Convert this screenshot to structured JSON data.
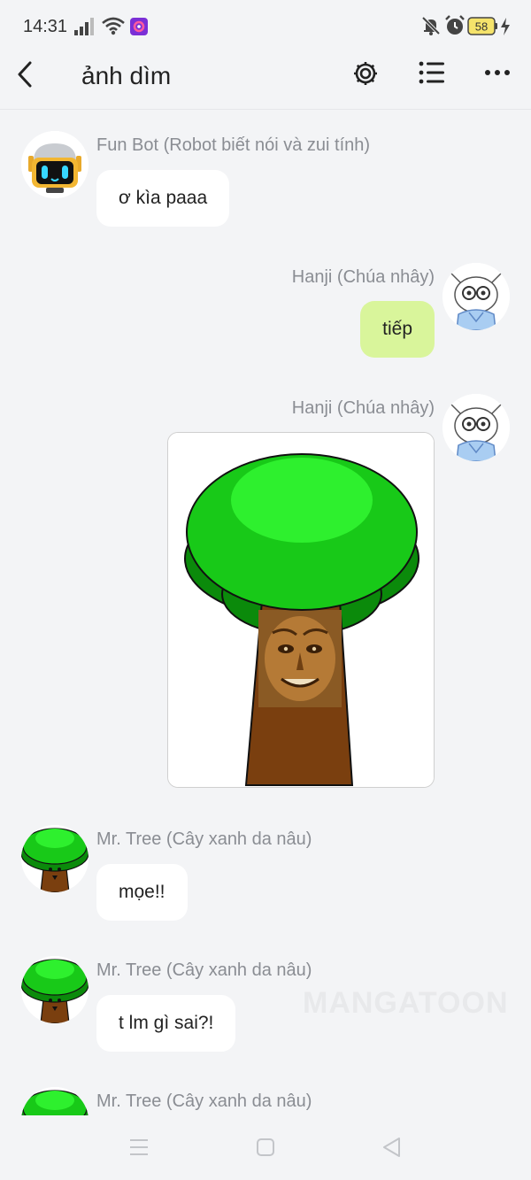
{
  "status_bar": {
    "time": "14:31",
    "battery": "58"
  },
  "header": {
    "title": "ảnh dìm"
  },
  "messages": [
    {
      "sender": "Fun Bot (Robot biết nói và zui tính)",
      "text": "ơ kìa paaa"
    },
    {
      "sender": "Hanji (Chúa nhây)",
      "text": "tiếp"
    },
    {
      "sender": "Hanji (Chúa nhây)"
    },
    {
      "sender": "Mr. Tree (Cây xanh da nâu)",
      "text": "mọe!!"
    },
    {
      "sender": "Mr. Tree (Cây xanh da nâu)",
      "text": "t lm gì sai?!"
    },
    {
      "sender": "Mr. Tree (Cây xanh da nâu)"
    }
  ],
  "watermark": "MANGATOON",
  "colors": {
    "background": "#f3f4f6",
    "outgoing_bubble": "#d9f59b",
    "incoming_bubble": "#ffffff",
    "sender_name": "#8a8d93"
  },
  "icons": [
    "signal-icon",
    "wifi-icon",
    "app-notification-icon",
    "mute-bell-icon",
    "alarm-icon",
    "battery-icon",
    "charging-icon",
    "back-icon",
    "settings-gear-icon",
    "list-menu-icon",
    "more-dots-icon",
    "nav-menu-icon",
    "nav-home-icon",
    "nav-back-icon"
  ]
}
